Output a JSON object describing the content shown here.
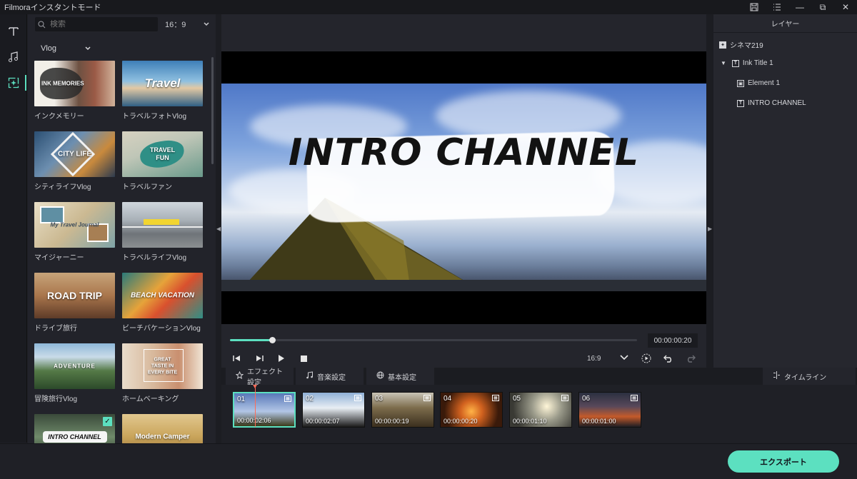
{
  "app": {
    "title": "Filmoraインスタントモード"
  },
  "window_controls": {
    "save_icon": "save-icon",
    "list_icon": "list-icon",
    "minimize": "—",
    "restore": "⧉",
    "close": "✕"
  },
  "rail": {
    "items": [
      "text-icon",
      "music-icon",
      "effects-icon"
    ],
    "active_index": 2
  },
  "browser": {
    "search_placeholder": "検索",
    "ratio": "16：9",
    "category": "Vlog",
    "templates": [
      {
        "name": "インクメモリー",
        "thumb_text": "INK MEMORIES",
        "selected": false
      },
      {
        "name": "トラベルフォトVlog",
        "thumb_text": "Travel",
        "selected": false
      },
      {
        "name": "シティライフVlog",
        "thumb_text": "CITY LIFE",
        "selected": false
      },
      {
        "name": "トラベルファン",
        "thumb_text": "TRAVEL FUN",
        "selected": false
      },
      {
        "name": "マイジャーニー",
        "thumb_text": "My Travel Journal",
        "selected": false
      },
      {
        "name": "トラベルライフVlog",
        "thumb_text": "",
        "selected": false
      },
      {
        "name": "ドライブ旅行",
        "thumb_text": "ROAD TRIP",
        "selected": false
      },
      {
        "name": "ビーチバケーションVlog",
        "thumb_text": "BEACH VACATION",
        "selected": false
      },
      {
        "name": "冒険旅行Vlog",
        "thumb_text": "ADVENTURE",
        "selected": false
      },
      {
        "name": "ホームベーキング",
        "thumb_text": "GREAT TASTE IN EVERY BITE",
        "selected": false
      },
      {
        "name": "",
        "thumb_text": "INTRO CHANNEL",
        "selected": true
      },
      {
        "name": "",
        "thumb_text": "Modern Camper",
        "selected": false
      }
    ]
  },
  "preview": {
    "overlay_title": "INTRO CHANNEL",
    "timecode": "00:00:00:20",
    "progress": 0.104,
    "aspect": "16:9"
  },
  "layers": {
    "header": "レイヤー",
    "items": [
      {
        "label": "シネマ219",
        "level": 0
      },
      {
        "label": "Ink Title 1",
        "level": 0,
        "expanded": true
      },
      {
        "label": "Element 1",
        "level": 1
      },
      {
        "label": "INTRO CHANNEL",
        "level": 1
      }
    ]
  },
  "bottom_tabs": {
    "effects": "エフェクト設定",
    "music": "音楽設定",
    "basic": "基本設定",
    "timeline": "タイムライン"
  },
  "clips": [
    {
      "num": "01",
      "duration": "00:00:02:06",
      "selected": true
    },
    {
      "num": "02",
      "duration": "00:00:02:07",
      "selected": false
    },
    {
      "num": "03",
      "duration": "00:00:00:19",
      "selected": false
    },
    {
      "num": "04",
      "duration": "00:00:00:20",
      "selected": false
    },
    {
      "num": "05",
      "duration": "00:00:01:10",
      "selected": false
    },
    {
      "num": "06",
      "duration": "00:00:01:00",
      "selected": false
    }
  ],
  "footer": {
    "export_label": "エクスポート"
  },
  "colors": {
    "accent": "#5ce0c0",
    "playhead": "#ff6b57"
  }
}
